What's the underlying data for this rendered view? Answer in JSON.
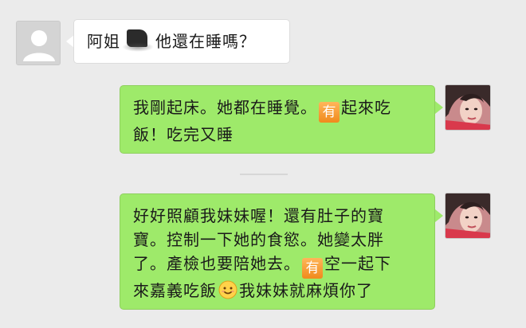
{
  "messages": [
    {
      "sender": "other",
      "avatar_icon": "default-user-avatar",
      "parts": [
        "阿姐",
        "[redacted]",
        "他還在睡嗎？"
      ]
    },
    {
      "sender": "self",
      "avatar_icon": "profile-photo",
      "parts": [
        "我剛起床。她都在睡覺。",
        "有",
        "起來吃",
        "飯！吃完又睡"
      ]
    },
    {
      "sender": "self",
      "avatar_icon": "profile-photo",
      "parts": [
        "好好照顧我妹妹喔！還有肚子的寶",
        "寶。控制一下她的食慾。她變太胖",
        "了。產檢也要陪她去。",
        "有",
        "空一起下",
        "來嘉義吃飯",
        "我妹妹就麻煩你了"
      ],
      "emoji": "smile-emoji"
    }
  ],
  "colors": {
    "background": "#ebebeb",
    "incoming_bubble": "#ffffff",
    "outgoing_bubble": "#9eea6a",
    "you_icon": "#f08a1c"
  }
}
